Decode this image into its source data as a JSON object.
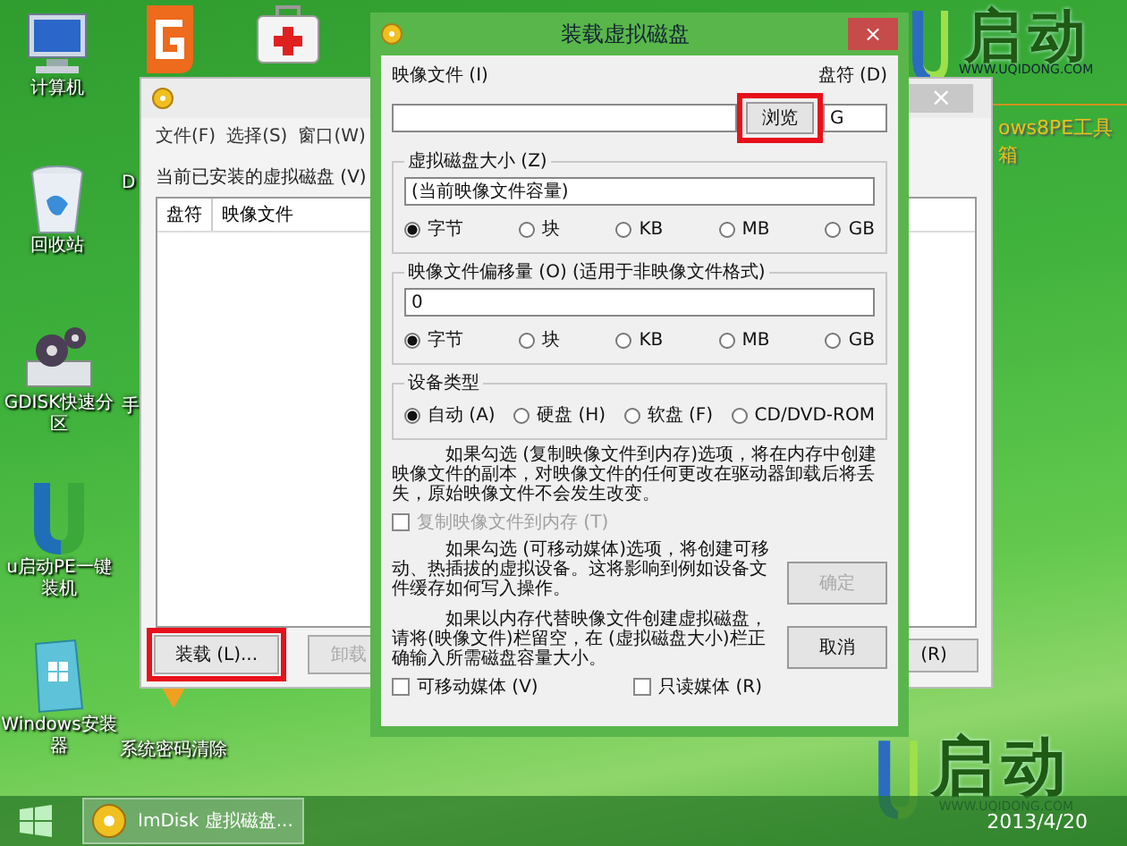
{
  "desktop_icons": [
    {
      "kind": "computer",
      "label": "计算机"
    },
    {
      "kind": "recycle",
      "label": "回收站"
    },
    {
      "kind": "gears",
      "label": "GDISK快速分区"
    },
    {
      "kind": "u-logo",
      "label": "u启动PE一键装机"
    },
    {
      "kind": "installer",
      "label": "Windows安装器"
    },
    {
      "kind": "orange-g",
      "label": "D"
    },
    {
      "kind": "first-aid"
    },
    {
      "kind": "label-only",
      "label": "手"
    },
    {
      "kind": "orange-shape",
      "label": "系统密码清除"
    }
  ],
  "brand_top": {
    "name": "启动",
    "url": "WWW.UQIDONG.COM",
    "subtitle": "ows8PE工具箱"
  },
  "brand_bottom": {
    "name": "启动",
    "url": "WWW.UQIDONG.COM"
  },
  "main_window": {
    "close": "×",
    "menu": [
      "文件(F)",
      "选择(S)",
      "窗口(W)"
    ],
    "list_label": "当前已安装的虚拟磁盘 (V)",
    "columns": [
      "盘符",
      "映像文件"
    ],
    "buttons": [
      {
        "label": "装载 (L)...",
        "disabled": false,
        "highlighted": true
      },
      {
        "label": "卸载",
        "disabled": true,
        "highlighted": false
      },
      {
        "label": "(R)",
        "disabled": false,
        "highlighted": false
      }
    ]
  },
  "dialog": {
    "title": "装载虚拟磁盘",
    "close": "×",
    "image_label": "映像文件 (I)",
    "drive_label": "盘符 (D)",
    "browse": {
      "label": "浏览",
      "highlighted": true
    },
    "drive_value": "G",
    "groups": [
      {
        "kind": "size",
        "legend": "虚拟磁盘大小 (Z)",
        "value": "(当前映像文件容量)",
        "options": [
          {
            "label": "字节",
            "selected": true
          },
          {
            "label": "块",
            "selected": false
          },
          {
            "label": "KB",
            "selected": false
          },
          {
            "label": "MB",
            "selected": false
          },
          {
            "label": "GB",
            "selected": false
          }
        ]
      },
      {
        "kind": "size",
        "legend": "映像文件偏移量 (O)  (适用于非映像文件格式)",
        "value": "0",
        "options": [
          {
            "label": "字节",
            "selected": true
          },
          {
            "label": "块",
            "selected": false
          },
          {
            "label": "KB",
            "selected": false
          },
          {
            "label": "MB",
            "selected": false
          },
          {
            "label": "GB",
            "selected": false
          }
        ]
      },
      {
        "kind": "device",
        "legend": "设备类型",
        "options": [
          {
            "label": "自动 (A)",
            "selected": true
          },
          {
            "label": "硬盘 (H)",
            "selected": false
          },
          {
            "label": "软盘 (F)",
            "selected": false
          },
          {
            "label": "CD/DVD-ROM",
            "selected": false
          }
        ]
      }
    ],
    "note1": "如果勾选 (复制映像文件到内存)选项，将在内存中创建映像文件的副本，对映像文件的任何更改在驱动器卸载后将丢失，原始映像文件不会发生改变。",
    "copy_checkbox": {
      "label": "复制映像文件到内存 (T)",
      "checked": false,
      "disabled": true
    },
    "note2": "如果勾选 (可移动媒体)选项，将创建可移动、热插拔的虚拟设备。这将影响到例如设备文件缓存如何写入操作。",
    "note3": "如果以内存代替映像文件创建虚拟磁盘，请将(映像文件)栏留空，在 (虚拟磁盘大小)栏正确输入所需磁盘容量大小。",
    "ok": {
      "label": "确定",
      "disabled": true
    },
    "cancel": {
      "label": "取消",
      "disabled": false
    },
    "bottom_checkboxes": [
      {
        "label": "可移动媒体 (V)",
        "checked": false
      },
      {
        "label": "只读媒体 (R)",
        "checked": false
      }
    ]
  },
  "taskbar": {
    "item": "ImDisk 虚拟磁盘...",
    "date": "2013/4/20"
  }
}
